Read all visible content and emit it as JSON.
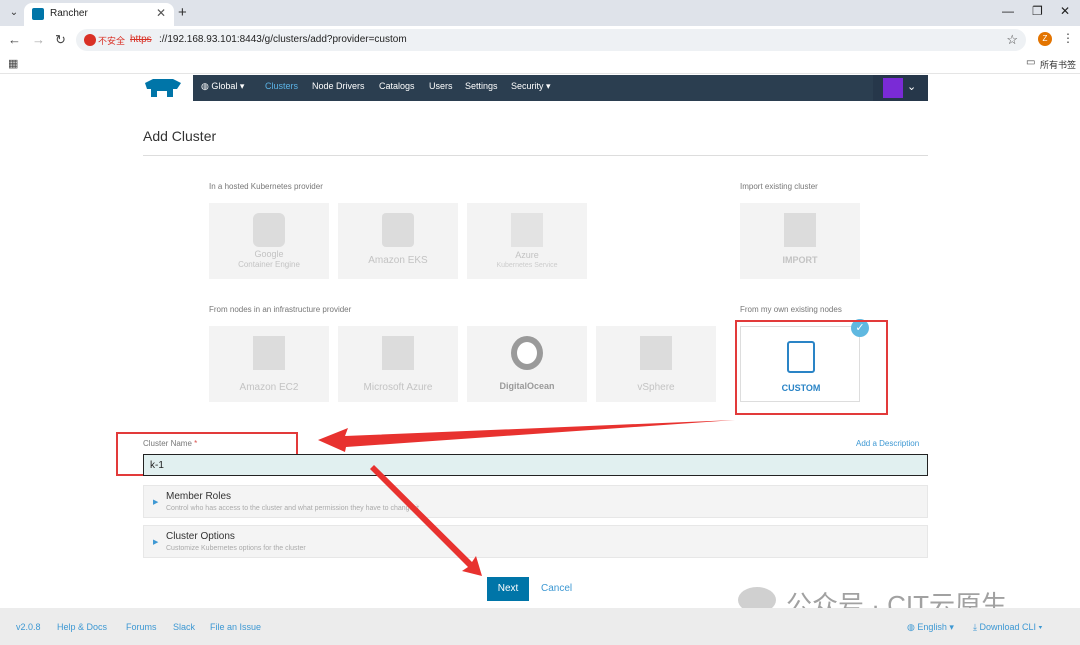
{
  "browser": {
    "tab_title": "Rancher",
    "insecure_label": "不安全",
    "url_scheme": "https",
    "url_rest": "://192.168.93.101:8443/g/clusters/add?provider=custom",
    "profile_initial": "Z",
    "all_bookmarks": "所有书签"
  },
  "nav": {
    "global": "Global",
    "items": [
      "Clusters",
      "Node Drivers",
      "Catalogs",
      "Users",
      "Settings",
      "Security"
    ]
  },
  "page_title": "Add Cluster",
  "sections": {
    "hosted": "In a hosted Kubernetes provider",
    "import": "Import existing cluster",
    "infra": "From nodes in an infrastructure provider",
    "own": "From my own existing nodes"
  },
  "cards": {
    "gke": {
      "line1": "Google",
      "line2": "Container Engine"
    },
    "eks": {
      "label": "Amazon EKS"
    },
    "azure_ks": {
      "line1": "Azure",
      "line2": "Kubernetes Service"
    },
    "import": {
      "label": "IMPORT"
    },
    "ec2": {
      "label": "Amazon EC2"
    },
    "msazure": {
      "label": "Microsoft Azure"
    },
    "do": {
      "label": "DigitalOcean"
    },
    "vsphere": {
      "label": "vSphere"
    },
    "custom": {
      "label": "CUSTOM"
    }
  },
  "form": {
    "cluster_name_label": "Cluster Name",
    "required_mark": "*",
    "add_description": "Add a Description",
    "cluster_name_value": "k-1"
  },
  "accordions": [
    {
      "title": "Member Roles",
      "subtitle": "Control who has access to the cluster and what permission they have to change it"
    },
    {
      "title": "Cluster Options",
      "subtitle": "Customize Kubernetes options for the cluster"
    }
  ],
  "buttons": {
    "next": "Next",
    "cancel": "Cancel"
  },
  "footer": {
    "version": "v2.0.8",
    "help": "Help & Docs",
    "forums": "Forums",
    "slack": "Slack",
    "issue": "File an Issue",
    "language": "English",
    "download": "Download CLI"
  },
  "watermark": "公众号 · CIT云原生",
  "colors": {
    "accent": "#0075a8",
    "nav_bg": "#2b3e50",
    "highlight": "#e23a3a"
  }
}
